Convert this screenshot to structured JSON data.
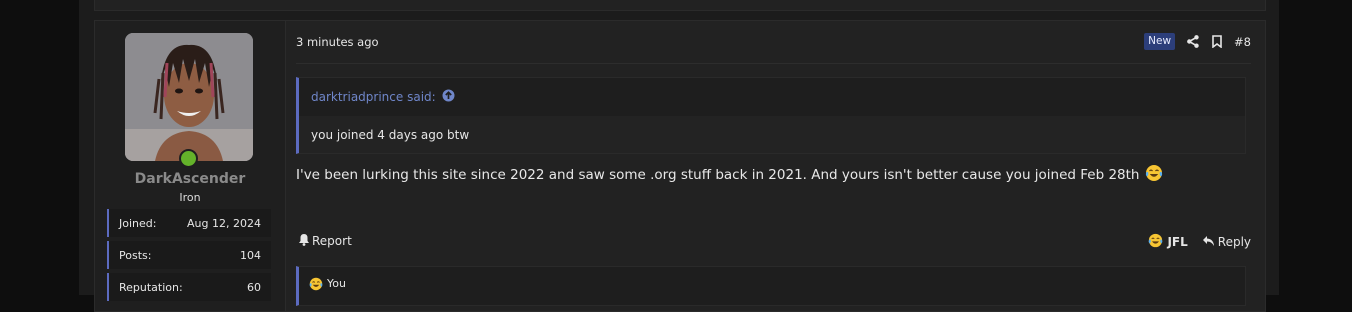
{
  "post": {
    "date": "3 minutes ago",
    "badge_new": "New",
    "number": "#8",
    "quote": {
      "author": "darktriadprince said:",
      "text": "you joined 4 days ago btw"
    },
    "message": "I've been lurking this site since 2022 and saw some .org stuff back in 2021. And yours isn't better cause you joined Feb 28th",
    "actions": {
      "report": "Report",
      "react": "JFL",
      "reply": "Reply"
    },
    "reactions_summary": "You"
  },
  "user": {
    "name": "DarkAscender",
    "title": "Iron",
    "stats": [
      {
        "label": "Joined:",
        "value": "Aug 12, 2024"
      },
      {
        "label": "Posts:",
        "value": "104"
      },
      {
        "label": "Reputation:",
        "value": "60"
      }
    ]
  },
  "icons": {
    "share": "share-icon",
    "bookmark": "bookmark-icon",
    "report": "bell-icon",
    "reply": "reply-icon",
    "quote_jump": "arrow-up-circle-icon",
    "emoji": "face-with-tears-of-joy"
  },
  "colors": {
    "accent": "#5c6bc0",
    "quote_link": "#6f86c9",
    "online": "#64b22a",
    "badge_new_bg": "#2c3e7a"
  }
}
